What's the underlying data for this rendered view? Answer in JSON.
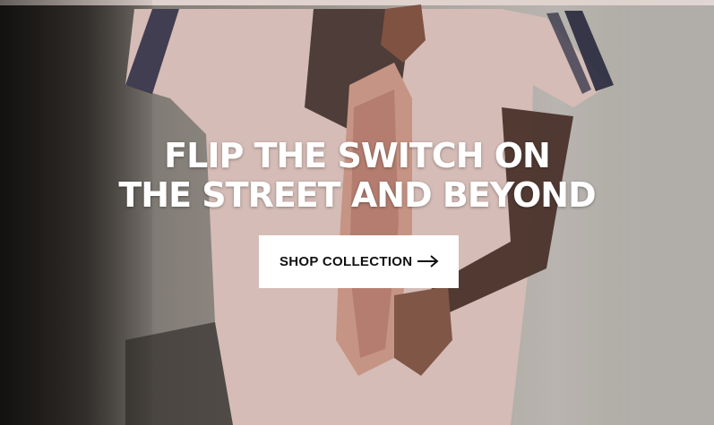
{
  "hero": {
    "headline_line1": "FLIP THE SWITCH ON",
    "headline_line2": "THE STREET AND BEYOND",
    "cta_label": "SHOP COLLECTION",
    "cta_icon": "arrow-right-icon"
  }
}
